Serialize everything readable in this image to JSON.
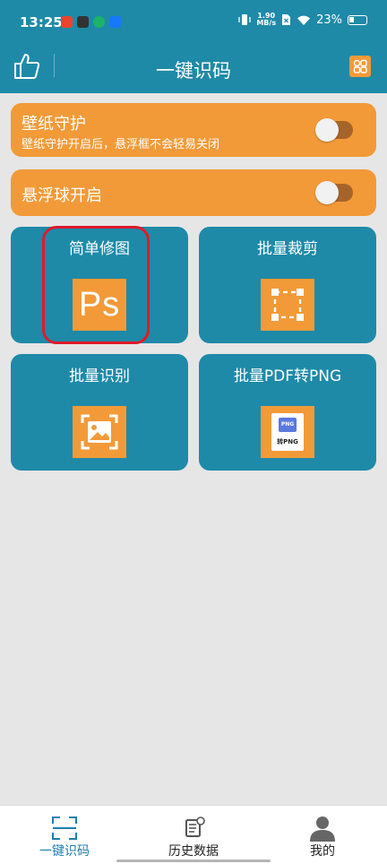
{
  "status_bar": {
    "time": "13:25",
    "net_speed_value": "1.90",
    "net_speed_unit": "MB/s",
    "battery": "23%"
  },
  "header": {
    "title": "一键识码"
  },
  "toggles": {
    "wallpaper": {
      "title": "壁纸守护",
      "subtitle": "壁纸守护开启后，悬浮框不会轻易关闭",
      "enabled": false
    },
    "floating_ball": {
      "title": "悬浮球开启",
      "enabled": false
    }
  },
  "tiles": {
    "simple_edit": {
      "label": "简单修图",
      "icon": "ps-icon",
      "icon_text": "Ps"
    },
    "batch_crop": {
      "label": "批量裁剪",
      "icon": "crop-icon"
    },
    "batch_recognize": {
      "label": "批量识别",
      "icon": "scan-image-icon"
    },
    "pdf_to_png": {
      "label": "批量PDF转PNG",
      "icon": "pdf-to-png-icon",
      "icon_badge": "PNG",
      "icon_caption": "转PNG"
    }
  },
  "bottom_nav": {
    "items": [
      {
        "label": "一键识码",
        "icon": "scan-frame-icon",
        "active": true
      },
      {
        "label": "历史数据",
        "icon": "history-doc-icon",
        "active": false
      },
      {
        "label": "我的",
        "icon": "profile-icon",
        "active": false
      }
    ]
  },
  "colors": {
    "primary": "#1e8aa8",
    "accent": "#f29a38",
    "background": "#e6e6e6",
    "highlight": "#e01a2a",
    "nav_active": "#1e7fb0"
  }
}
